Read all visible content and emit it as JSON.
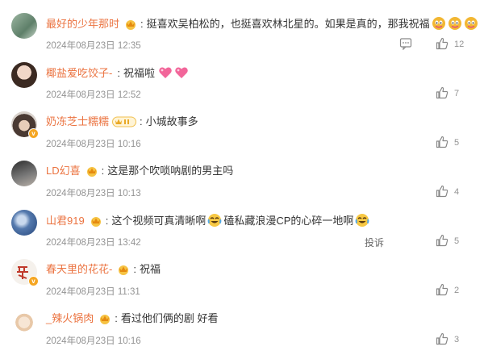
{
  "comments": [
    {
      "username": "最好的少年那时",
      "text": "挺喜欢吴柏松的，也挺喜欢林北星的。如果是真的，那我祝福",
      "time": "2024年08月23日 12:35",
      "likes": "12",
      "badge": "crown",
      "emoji_trail": [
        "doge",
        "doge",
        "doge"
      ],
      "show_reply": true
    },
    {
      "username": "椰盐爱吃饺子-",
      "text": "祝福啦",
      "time": "2024年08月23日 12:52",
      "likes": "7",
      "badge": "none",
      "emoji_trail": [
        "heart",
        "heart"
      ],
      "show_reply": false
    },
    {
      "username": "奶冻芝士糯糯",
      "text": "小城故事多",
      "time": "2024年08月23日 10:16",
      "likes": "5",
      "badge": "pill",
      "emoji_trail": [],
      "show_reply": false
    },
    {
      "username": "LD幻喜",
      "text": "这是那个吹唢呐剧的男主吗",
      "time": "2024年08月23日 10:13",
      "likes": "4",
      "badge": "crown",
      "emoji_trail": [],
      "show_reply": false
    },
    {
      "username": "山君919",
      "text_parts": [
        "这个视频可真清晰啊",
        "磕私藏浪漫CP的心碎一地啊"
      ],
      "time": "2024年08月23日 13:42",
      "likes": "5",
      "badge": "crown",
      "report_label": "投诉",
      "show_reply": false
    },
    {
      "username": "春天里的花花-",
      "text": "祝福",
      "time": "2024年08月23日 11:31",
      "likes": "2",
      "badge": "crown",
      "emoji_trail": [],
      "show_reply": false
    },
    {
      "username": "_辣火锅肉",
      "text": "看过他们俩的剧 好看",
      "time": "2024年08月23日 10:16",
      "likes": "3",
      "badge": "crown",
      "emoji_trail": [],
      "show_reply": false
    }
  ],
  "colors": {
    "username": "#eb7340",
    "time": "#939393",
    "text": "#333333",
    "badge": "#f5a623"
  }
}
